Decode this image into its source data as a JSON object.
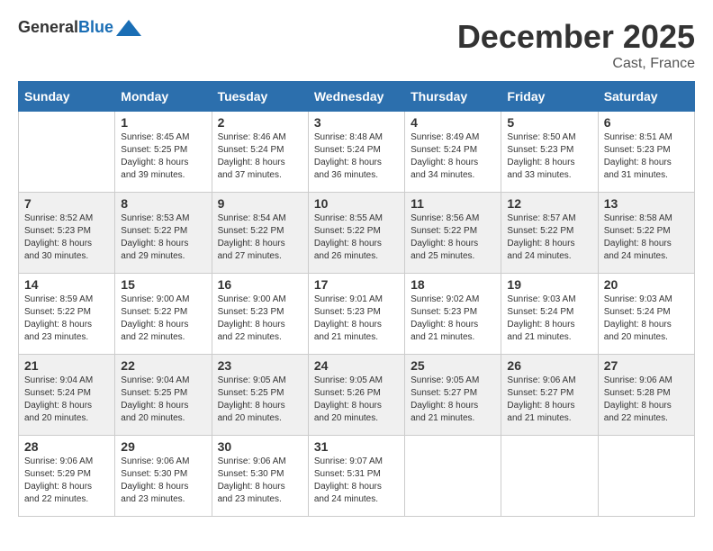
{
  "header": {
    "logo_general": "General",
    "logo_blue": "Blue",
    "month": "December 2025",
    "location": "Cast, France"
  },
  "weekdays": [
    "Sunday",
    "Monday",
    "Tuesday",
    "Wednesday",
    "Thursday",
    "Friday",
    "Saturday"
  ],
  "rows": [
    [
      {
        "day": "",
        "sunrise": "",
        "sunset": "",
        "daylight": ""
      },
      {
        "day": "1",
        "sunrise": "Sunrise: 8:45 AM",
        "sunset": "Sunset: 5:25 PM",
        "daylight": "Daylight: 8 hours and 39 minutes."
      },
      {
        "day": "2",
        "sunrise": "Sunrise: 8:46 AM",
        "sunset": "Sunset: 5:24 PM",
        "daylight": "Daylight: 8 hours and 37 minutes."
      },
      {
        "day": "3",
        "sunrise": "Sunrise: 8:48 AM",
        "sunset": "Sunset: 5:24 PM",
        "daylight": "Daylight: 8 hours and 36 minutes."
      },
      {
        "day": "4",
        "sunrise": "Sunrise: 8:49 AM",
        "sunset": "Sunset: 5:24 PM",
        "daylight": "Daylight: 8 hours and 34 minutes."
      },
      {
        "day": "5",
        "sunrise": "Sunrise: 8:50 AM",
        "sunset": "Sunset: 5:23 PM",
        "daylight": "Daylight: 8 hours and 33 minutes."
      },
      {
        "day": "6",
        "sunrise": "Sunrise: 8:51 AM",
        "sunset": "Sunset: 5:23 PM",
        "daylight": "Daylight: 8 hours and 31 minutes."
      }
    ],
    [
      {
        "day": "7",
        "sunrise": "Sunrise: 8:52 AM",
        "sunset": "Sunset: 5:23 PM",
        "daylight": "Daylight: 8 hours and 30 minutes."
      },
      {
        "day": "8",
        "sunrise": "Sunrise: 8:53 AM",
        "sunset": "Sunset: 5:22 PM",
        "daylight": "Daylight: 8 hours and 29 minutes."
      },
      {
        "day": "9",
        "sunrise": "Sunrise: 8:54 AM",
        "sunset": "Sunset: 5:22 PM",
        "daylight": "Daylight: 8 hours and 27 minutes."
      },
      {
        "day": "10",
        "sunrise": "Sunrise: 8:55 AM",
        "sunset": "Sunset: 5:22 PM",
        "daylight": "Daylight: 8 hours and 26 minutes."
      },
      {
        "day": "11",
        "sunrise": "Sunrise: 8:56 AM",
        "sunset": "Sunset: 5:22 PM",
        "daylight": "Daylight: 8 hours and 25 minutes."
      },
      {
        "day": "12",
        "sunrise": "Sunrise: 8:57 AM",
        "sunset": "Sunset: 5:22 PM",
        "daylight": "Daylight: 8 hours and 24 minutes."
      },
      {
        "day": "13",
        "sunrise": "Sunrise: 8:58 AM",
        "sunset": "Sunset: 5:22 PM",
        "daylight": "Daylight: 8 hours and 24 minutes."
      }
    ],
    [
      {
        "day": "14",
        "sunrise": "Sunrise: 8:59 AM",
        "sunset": "Sunset: 5:22 PM",
        "daylight": "Daylight: 8 hours and 23 minutes."
      },
      {
        "day": "15",
        "sunrise": "Sunrise: 9:00 AM",
        "sunset": "Sunset: 5:22 PM",
        "daylight": "Daylight: 8 hours and 22 minutes."
      },
      {
        "day": "16",
        "sunrise": "Sunrise: 9:00 AM",
        "sunset": "Sunset: 5:23 PM",
        "daylight": "Daylight: 8 hours and 22 minutes."
      },
      {
        "day": "17",
        "sunrise": "Sunrise: 9:01 AM",
        "sunset": "Sunset: 5:23 PM",
        "daylight": "Daylight: 8 hours and 21 minutes."
      },
      {
        "day": "18",
        "sunrise": "Sunrise: 9:02 AM",
        "sunset": "Sunset: 5:23 PM",
        "daylight": "Daylight: 8 hours and 21 minutes."
      },
      {
        "day": "19",
        "sunrise": "Sunrise: 9:03 AM",
        "sunset": "Sunset: 5:24 PM",
        "daylight": "Daylight: 8 hours and 21 minutes."
      },
      {
        "day": "20",
        "sunrise": "Sunrise: 9:03 AM",
        "sunset": "Sunset: 5:24 PM",
        "daylight": "Daylight: 8 hours and 20 minutes."
      }
    ],
    [
      {
        "day": "21",
        "sunrise": "Sunrise: 9:04 AM",
        "sunset": "Sunset: 5:24 PM",
        "daylight": "Daylight: 8 hours and 20 minutes."
      },
      {
        "day": "22",
        "sunrise": "Sunrise: 9:04 AM",
        "sunset": "Sunset: 5:25 PM",
        "daylight": "Daylight: 8 hours and 20 minutes."
      },
      {
        "day": "23",
        "sunrise": "Sunrise: 9:05 AM",
        "sunset": "Sunset: 5:25 PM",
        "daylight": "Daylight: 8 hours and 20 minutes."
      },
      {
        "day": "24",
        "sunrise": "Sunrise: 9:05 AM",
        "sunset": "Sunset: 5:26 PM",
        "daylight": "Daylight: 8 hours and 20 minutes."
      },
      {
        "day": "25",
        "sunrise": "Sunrise: 9:05 AM",
        "sunset": "Sunset: 5:27 PM",
        "daylight": "Daylight: 8 hours and 21 minutes."
      },
      {
        "day": "26",
        "sunrise": "Sunrise: 9:06 AM",
        "sunset": "Sunset: 5:27 PM",
        "daylight": "Daylight: 8 hours and 21 minutes."
      },
      {
        "day": "27",
        "sunrise": "Sunrise: 9:06 AM",
        "sunset": "Sunset: 5:28 PM",
        "daylight": "Daylight: 8 hours and 22 minutes."
      }
    ],
    [
      {
        "day": "28",
        "sunrise": "Sunrise: 9:06 AM",
        "sunset": "Sunset: 5:29 PM",
        "daylight": "Daylight: 8 hours and 22 minutes."
      },
      {
        "day": "29",
        "sunrise": "Sunrise: 9:06 AM",
        "sunset": "Sunset: 5:30 PM",
        "daylight": "Daylight: 8 hours and 23 minutes."
      },
      {
        "day": "30",
        "sunrise": "Sunrise: 9:06 AM",
        "sunset": "Sunset: 5:30 PM",
        "daylight": "Daylight: 8 hours and 23 minutes."
      },
      {
        "day": "31",
        "sunrise": "Sunrise: 9:07 AM",
        "sunset": "Sunset: 5:31 PM",
        "daylight": "Daylight: 8 hours and 24 minutes."
      },
      {
        "day": "",
        "sunrise": "",
        "sunset": "",
        "daylight": ""
      },
      {
        "day": "",
        "sunrise": "",
        "sunset": "",
        "daylight": ""
      },
      {
        "day": "",
        "sunrise": "",
        "sunset": "",
        "daylight": ""
      }
    ]
  ]
}
